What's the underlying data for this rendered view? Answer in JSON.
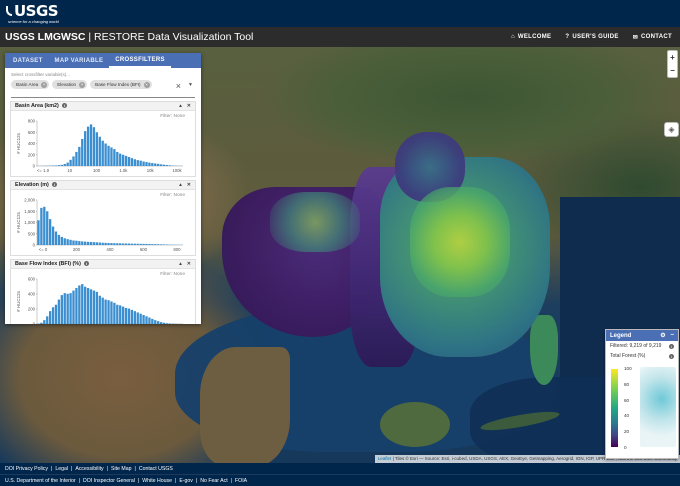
{
  "logo": {
    "text": "USGS",
    "tagline": "science for a changing world"
  },
  "header": {
    "app_title_bold": "USGS LMGWSC",
    "app_title_rest": " | RESTORE Data Visualization Tool",
    "nav": [
      {
        "icon": "home-icon",
        "glyph": "⌂",
        "label": "WELCOME"
      },
      {
        "icon": "help-icon",
        "glyph": "?",
        "label": "USER'S GUIDE"
      },
      {
        "icon": "mail-icon",
        "glyph": "✉",
        "label": "CONTACT"
      }
    ]
  },
  "panel": {
    "tabs": [
      "DATASET",
      "MAP VARIABLE",
      "CROSSFILTERS"
    ],
    "active_tab": "CROSSFILTERS",
    "selector_label": "Select crossfilter variable(s)...",
    "chips": [
      "Basin Area",
      "Elevation",
      "Base Flow Index (BFI)"
    ],
    "filters": [
      {
        "title": "Basin Area (km2)",
        "filter_text": "Filter: None",
        "ylabel": "# HUC12s",
        "yticks": [
          "800",
          "600",
          "400",
          "200",
          "0"
        ],
        "ymax": 800,
        "xticks": [
          "<= 1.0",
          "10",
          "100",
          "1.0k",
          "10k",
          "100k"
        ],
        "values": [
          2,
          3,
          4,
          5,
          6,
          8,
          10,
          15,
          20,
          35,
          60,
          110,
          170,
          250,
          340,
          480,
          620,
          700,
          740,
          690,
          600,
          520,
          450,
          400,
          360,
          330,
          300,
          250,
          220,
          200,
          180,
          160,
          140,
          120,
          105,
          95,
          80,
          70,
          60,
          52,
          45,
          38,
          30,
          24,
          18,
          12,
          8,
          5,
          3,
          2
        ]
      },
      {
        "title": "Elevation (m)",
        "filter_text": "Filter: None",
        "ylabel": "# HUC12s",
        "yticks": [
          "2,000",
          "1,500",
          "1,000",
          "500",
          "0"
        ],
        "ymax": 2000,
        "xticks": [
          "<= 0",
          "200",
          "400",
          "600",
          "800"
        ],
        "values": [
          1100,
          1650,
          1700,
          1500,
          1150,
          820,
          600,
          450,
          360,
          300,
          260,
          230,
          200,
          190,
          175,
          160,
          150,
          140,
          135,
          125,
          120,
          110,
          100,
          95,
          90,
          85,
          80,
          78,
          75,
          70,
          68,
          65,
          60,
          58,
          55,
          52,
          50,
          48,
          45,
          40,
          38,
          35,
          30,
          25,
          20,
          15,
          12,
          10,
          8,
          6
        ]
      },
      {
        "title": "Base Flow Index (BFI) (%)",
        "filter_text": "Filter: None",
        "ylabel": "# HUC12s",
        "yticks": [
          "600",
          "400",
          "200",
          "0"
        ],
        "ymax": 700,
        "xticks": [
          "0",
          "20",
          "40",
          "60",
          "80"
        ],
        "values": [
          5,
          20,
          60,
          120,
          200,
          260,
          300,
          380,
          450,
          480,
          470,
          480,
          520,
          560,
          600,
          620,
          580,
          560,
          540,
          520,
          500,
          440,
          410,
          380,
          370,
          350,
          330,
          300,
          290,
          270,
          250,
          240,
          220,
          200,
          180,
          160,
          140,
          120,
          100,
          80,
          60,
          45,
          30,
          20,
          12,
          8,
          5,
          3,
          2,
          1
        ]
      }
    ]
  },
  "legend": {
    "title": "Legend",
    "filtered_text": "Filtered: 9,219 of 9,219",
    "variable": "Total Forest (%)",
    "ticks": [
      "100",
      "80",
      "60",
      "40",
      "20",
      "0"
    ]
  },
  "map": {
    "zoom_in": "+",
    "zoom_out": "−",
    "attribution_link": "Leaflet",
    "attribution_text": " | Tiles © Esri — Source: Esri, i-cubed, USDA, USGS, AEX, GeoEye, Getmapping, Aerogrid, IGN, IGP, UPR-EGP, and the GIS User Community"
  },
  "footer": {
    "row1": [
      "DOI Privacy Policy",
      "Legal",
      "Accessibility",
      "Site Map",
      "Contact USGS"
    ],
    "row2": [
      "U.S. Department of the Interior",
      "DOI Inspector General",
      "White House",
      "E-gov",
      "No Fear Act",
      "FOIA"
    ]
  },
  "colors": {
    "bar": "#3b8fd0",
    "accent": "#4a6fb5",
    "navy": "#00264c"
  }
}
